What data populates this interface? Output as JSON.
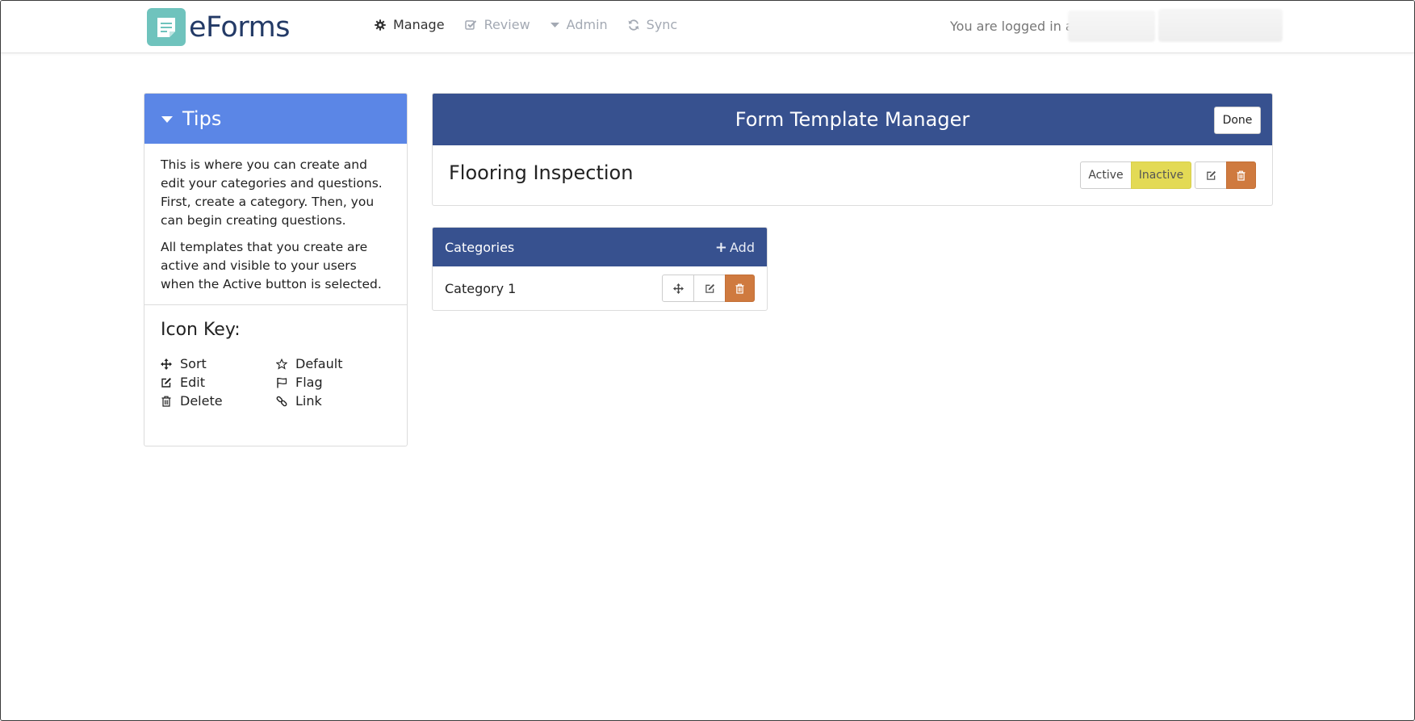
{
  "app": {
    "name": "eForms",
    "nav": [
      {
        "label": "Manage",
        "icon": "gear-icon",
        "active": true
      },
      {
        "label": "Review",
        "icon": "check-square-icon",
        "active": false
      },
      {
        "label": "Admin",
        "icon": "caret-down-icon",
        "active": false
      },
      {
        "label": "Sync",
        "icon": "refresh-icon",
        "active": false
      }
    ],
    "login_text": "You are logged in as"
  },
  "tips": {
    "title": "Tips",
    "paragraph1": "This is where you can create and edit your categories and questions. First, create a category. Then, you can begin creating questions.",
    "paragraph2": "All templates that you create are active and visible to your users when the Active button is selected.",
    "icon_key_title": "Icon Key:",
    "icon_key": [
      {
        "label": "Sort",
        "icon": "arrows-move-icon"
      },
      {
        "label": "Default",
        "icon": "star-icon"
      },
      {
        "label": "Edit",
        "icon": "edit-icon"
      },
      {
        "label": "Flag",
        "icon": "flag-icon"
      },
      {
        "label": "Delete",
        "icon": "trash-icon"
      },
      {
        "label": "Link",
        "icon": "link-icon"
      }
    ]
  },
  "manager": {
    "title": "Form Template Manager",
    "done_label": "Done",
    "template_name": "Flooring Inspection",
    "active_label": "Active",
    "inactive_label": "Inactive",
    "selected_status": "Inactive"
  },
  "categories": {
    "title": "Categories",
    "add_label": "Add",
    "items": [
      {
        "name": "Category 1"
      }
    ]
  },
  "colors": {
    "header_blue": "#37518f",
    "tips_blue": "#5b86e6",
    "inactive_yellow": "#e3da55",
    "delete_orange": "#cf7a3f",
    "logo_teal": "#6fc3bd"
  }
}
